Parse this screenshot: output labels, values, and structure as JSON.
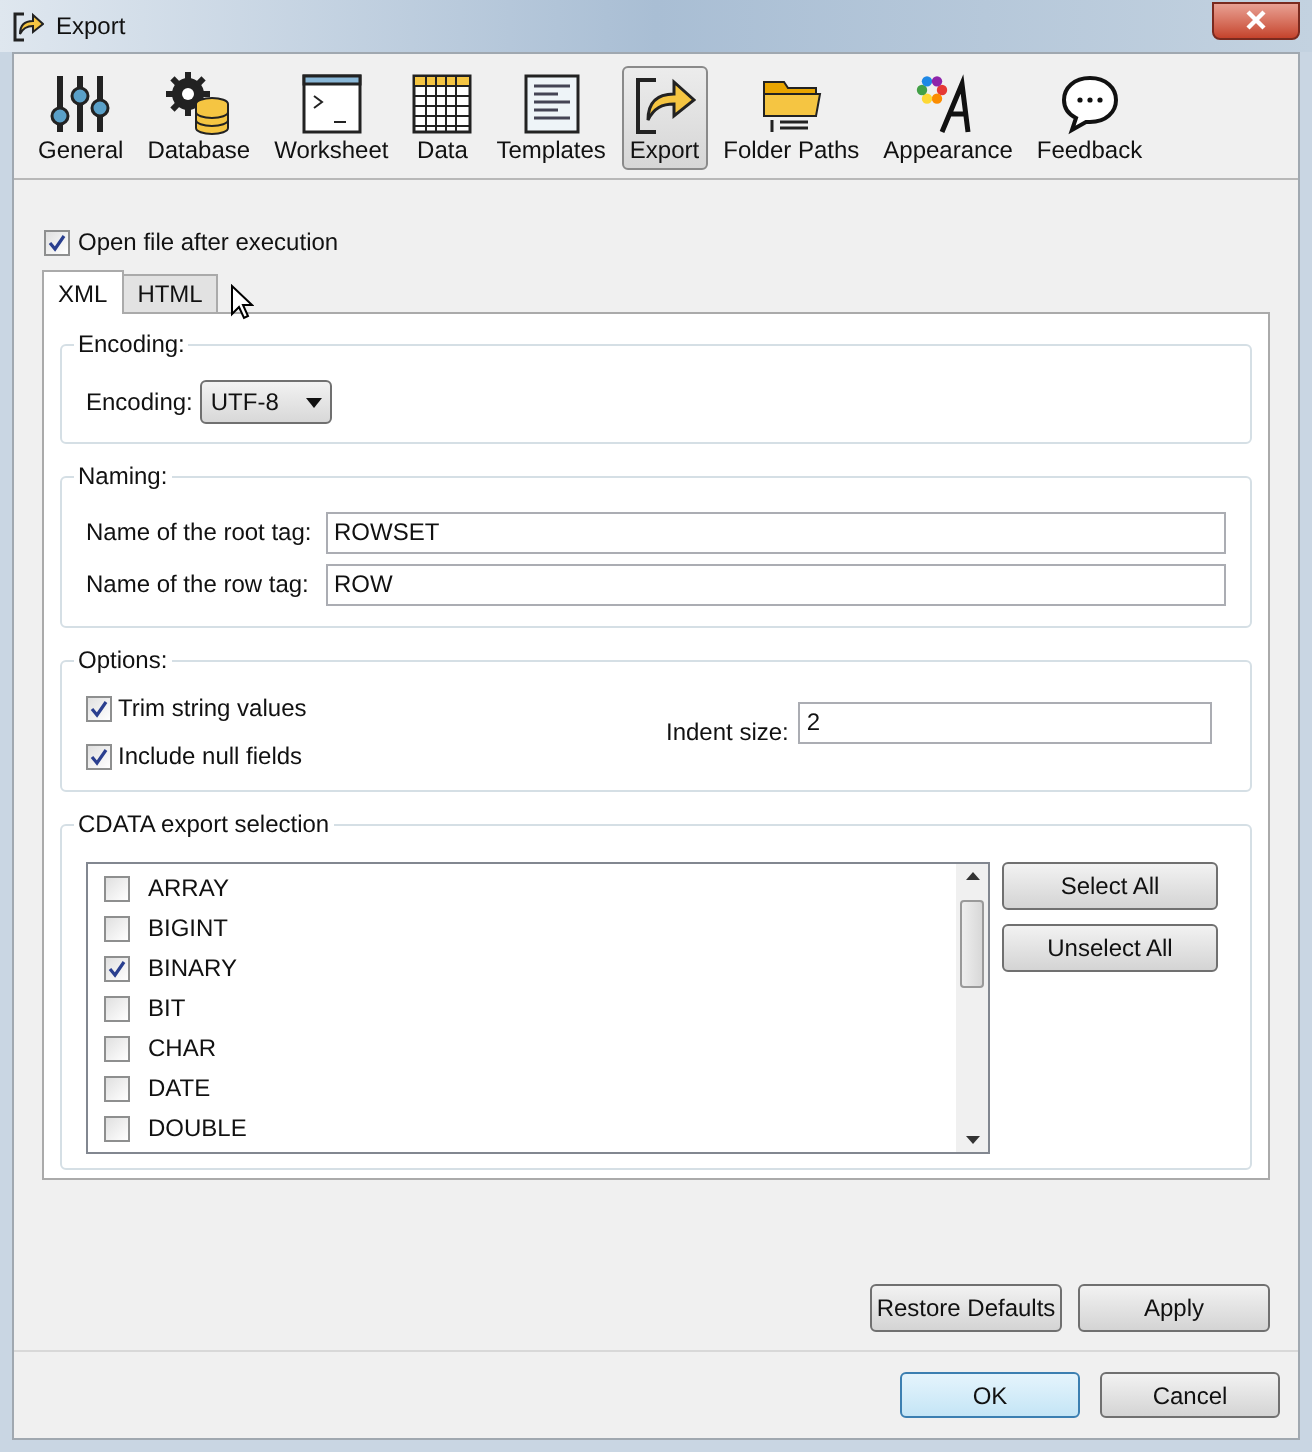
{
  "window": {
    "title": "Export"
  },
  "toolbar": [
    {
      "label": "General",
      "kind": "sliders",
      "selected": false
    },
    {
      "label": "Database",
      "kind": "database",
      "selected": false
    },
    {
      "label": "Worksheet",
      "kind": "terminal",
      "selected": false
    },
    {
      "label": "Data",
      "kind": "grid",
      "selected": false
    },
    {
      "label": "Templates",
      "kind": "document",
      "selected": false
    },
    {
      "label": "Export",
      "kind": "export",
      "selected": true
    },
    {
      "label": "Folder Paths",
      "kind": "folder",
      "selected": false
    },
    {
      "label": "Appearance",
      "kind": "palette",
      "selected": false
    },
    {
      "label": "Feedback",
      "kind": "chat",
      "selected": false
    }
  ],
  "open_after": {
    "label": "Open file after execution",
    "checked": true
  },
  "tabs": [
    {
      "label": "XML",
      "selected": true
    },
    {
      "label": "HTML",
      "selected": false
    }
  ],
  "encoding": {
    "title": "Encoding:",
    "label": "Encoding:",
    "value": "UTF-8"
  },
  "naming": {
    "title": "Naming:",
    "fields": [
      {
        "label": "Name of the root tag:",
        "value": "ROWSET"
      },
      {
        "label": "Name of the row tag:",
        "value": "ROW"
      }
    ]
  },
  "options": {
    "title": "Options:",
    "checkboxes": [
      {
        "label": "Trim string values",
        "checked": true
      },
      {
        "label": "Include null fields",
        "checked": true
      }
    ],
    "indent": {
      "label": "Indent size:",
      "value": "2"
    }
  },
  "cdata": {
    "title": "CDATA export selection",
    "items": [
      {
        "label": "ARRAY",
        "checked": false
      },
      {
        "label": "BIGINT",
        "checked": false
      },
      {
        "label": "BINARY",
        "checked": true
      },
      {
        "label": "BIT",
        "checked": false
      },
      {
        "label": "CHAR",
        "checked": false
      },
      {
        "label": "DATE",
        "checked": false
      },
      {
        "label": "DOUBLE",
        "checked": false
      }
    ],
    "buttons": [
      "Select All",
      "Unselect All"
    ]
  },
  "footer_buttons": [
    "Restore Defaults",
    "Apply"
  ],
  "dialog_buttons": [
    {
      "label": "OK",
      "default": true
    },
    {
      "label": "Cancel",
      "default": false
    }
  ]
}
